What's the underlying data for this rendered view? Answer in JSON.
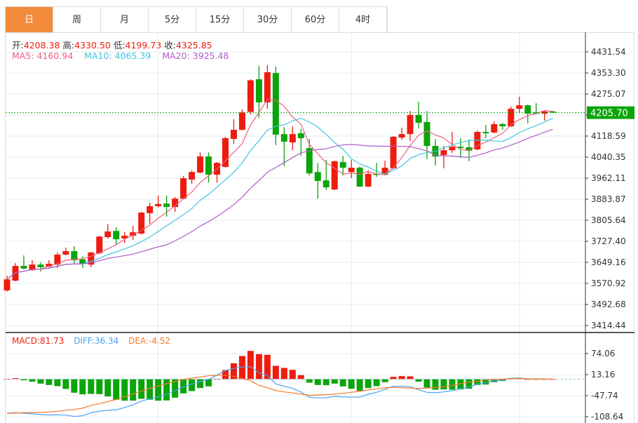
{
  "tabs": [
    {
      "label": "日",
      "active": true
    },
    {
      "label": "周",
      "active": false
    },
    {
      "label": "月",
      "active": false
    },
    {
      "label": "5分",
      "active": false
    },
    {
      "label": "15分",
      "active": false
    },
    {
      "label": "30分",
      "active": false
    },
    {
      "label": "60分",
      "active": false
    },
    {
      "label": "4时",
      "active": false
    }
  ],
  "ohlc_info": {
    "open_label": "开:",
    "open": "4208.38",
    "high_label": "高:",
    "high": "4330.50",
    "low_label": "低:",
    "low": "4199.73",
    "close_label": "收:",
    "close": "4325.85"
  },
  "ma_info": {
    "ma5": "MA5: 4160.94",
    "ma10": "MA10: 4065.39",
    "ma20": "MA20: 3925.48"
  },
  "macd_info": {
    "macd": "MACD:81.73",
    "diff": "DIFF:36.34",
    "dea": "DEA:-4.52"
  },
  "colors": {
    "up": "#ee1c0f",
    "down": "#0aa50a",
    "ma5": "#f0607f",
    "ma10": "#3fc6e0",
    "ma20": "#b05cc8",
    "diff": "#4aa3f0",
    "dea": "#f7792a",
    "active_tab": "#f28b3c",
    "last_price_bg": "#0aa50a"
  },
  "chart_data": [
    {
      "type": "candlestick",
      "price_ticks": [
        "4431.54",
        "4353.30",
        "4275.07",
        "4196.83",
        "4118.59",
        "4040.35",
        "3962.11",
        "3883.87",
        "3805.64",
        "3727.40",
        "3649.16",
        "3570.92",
        "3492.68",
        "3414.44"
      ],
      "last_price": "4205.70",
      "candle_fields": [
        "open",
        "close",
        "high",
        "low"
      ],
      "candles": [
        [
          3545,
          3586,
          3600,
          3540
        ],
        [
          3581,
          3636,
          3646,
          3579
        ],
        [
          3636,
          3626,
          3675,
          3623
        ],
        [
          3620,
          3641,
          3657,
          3618
        ],
        [
          3641,
          3631,
          3649,
          3615
        ],
        [
          3633,
          3644,
          3657,
          3631
        ],
        [
          3641,
          3678,
          3686,
          3628
        ],
        [
          3678,
          3691,
          3704,
          3675
        ],
        [
          3691,
          3657,
          3709,
          3646
        ],
        [
          3660,
          3644,
          3672,
          3628
        ],
        [
          3641,
          3686,
          3688,
          3631
        ],
        [
          3683,
          3745,
          3748,
          3680
        ],
        [
          3743,
          3764,
          3792,
          3738
        ],
        [
          3766,
          3735,
          3780,
          3717
        ],
        [
          3738,
          3748,
          3761,
          3722
        ],
        [
          3748,
          3761,
          3785,
          3733
        ],
        [
          3756,
          3834,
          3837,
          3753
        ],
        [
          3832,
          3858,
          3871,
          3792
        ],
        [
          3858,
          3866,
          3897,
          3853
        ],
        [
          3868,
          3855,
          3897,
          3819
        ],
        [
          3855,
          3886,
          3892,
          3837
        ],
        [
          3886,
          3962,
          3970,
          3884
        ],
        [
          3957,
          3985,
          3991,
          3941
        ],
        [
          3983,
          4043,
          4058,
          3980
        ],
        [
          4043,
          3975,
          4058,
          3946
        ],
        [
          3975,
          4019,
          4022,
          3946
        ],
        [
          4004,
          4111,
          4116,
          4001
        ],
        [
          4108,
          4142,
          4181,
          4090
        ],
        [
          4142,
          4207,
          4218,
          4139
        ],
        [
          4208.38,
          4325.85,
          4330.5,
          4199.73
        ],
        [
          4330,
          4244,
          4379,
          4186
        ],
        [
          4244,
          4356,
          4382,
          4220
        ],
        [
          4353,
          4124,
          4377,
          4085
        ],
        [
          4126,
          4098,
          4152,
          4006
        ],
        [
          4095,
          4126,
          4155,
          4066
        ],
        [
          4129,
          4111,
          4145,
          4045
        ],
        [
          4074,
          3980,
          4108,
          3972
        ],
        [
          3985,
          3952,
          4019,
          3886
        ],
        [
          3954,
          3928,
          4030,
          3918
        ],
        [
          3920,
          4025,
          4027,
          3918
        ],
        [
          4022,
          4001,
          4045,
          3972
        ],
        [
          3985,
          4001,
          4030,
          3962
        ],
        [
          4001,
          3931,
          4006,
          3928
        ],
        [
          3931,
          3978,
          3991,
          3928
        ],
        [
          3978,
          3975,
          4019,
          3967
        ],
        [
          3975,
          4001,
          4027,
          3972
        ],
        [
          3999,
          4116,
          4119,
          3996
        ],
        [
          4113,
          4126,
          4150,
          4105
        ],
        [
          4126,
          4197,
          4212,
          4100
        ],
        [
          4197,
          4168,
          4246,
          4147
        ],
        [
          4171,
          4082,
          4212,
          4033
        ],
        [
          4082,
          4043,
          4108,
          4009
        ],
        [
          4048,
          4066,
          4082,
          3999
        ],
        [
          4066,
          4079,
          4134,
          4056
        ],
        [
          4079,
          4074,
          4111,
          4038
        ],
        [
          4077,
          4064,
          4106,
          4025
        ],
        [
          4069,
          4134,
          4139,
          4066
        ],
        [
          4134,
          4129,
          4160,
          4111
        ],
        [
          4132,
          4163,
          4173,
          4129
        ],
        [
          4163,
          4155,
          4168,
          4142
        ],
        [
          4155,
          4220,
          4228,
          4152
        ],
        [
          4220,
          4233,
          4265,
          4205
        ],
        [
          4233,
          4202,
          4236,
          4166
        ],
        [
          4207,
          4202,
          4241,
          4199
        ],
        [
          4202,
          4210,
          4215,
          4176
        ],
        [
          4210,
          4205.7,
          4212,
          4204
        ]
      ],
      "moving_averages": [
        5,
        10,
        20
      ],
      "grid": true
    },
    {
      "type": "bar+line",
      "name": "MACD",
      "ticks": [
        "74.06",
        "13.16",
        "-47.74",
        "-108.64"
      ],
      "macd": [
        1,
        2.7,
        -3.4,
        -7.4,
        -12.9,
        -16.9,
        -20.3,
        -28.4,
        -39.3,
        -44,
        -42.7,
        -43.3,
        -50.1,
        -59.6,
        -62.3,
        -62.3,
        -56.9,
        -59.6,
        -62.3,
        -61.6,
        -53.5,
        -41.3,
        -34.5,
        -25.7,
        -21,
        1,
        26.4,
        46,
        67,
        81.73,
        72.4,
        70.4,
        38.6,
        32.5,
        27,
        11.5,
        -10.2,
        -16.9,
        -17.6,
        -12.9,
        -21,
        -27.8,
        -33.9,
        -25.7,
        -20.3,
        -8.8,
        6.8,
        8.8,
        8.1,
        -7.4,
        -24.4,
        -30.5,
        -29.8,
        -30.5,
        -29.8,
        -27.8,
        -16.9,
        -15.6,
        -8.8,
        -5.4,
        2.7,
        2.7,
        0,
        0,
        0,
        0
      ],
      "diff": [
        -98.5,
        -96.7,
        -98.7,
        -100.2,
        -102.5,
        -103.5,
        -103.2,
        -104.2,
        -107.7,
        -106,
        -97.4,
        -92.7,
        -90.1,
        -88.8,
        -82.2,
        -74.2,
        -63.5,
        -56.8,
        -51.2,
        -43.8,
        -33.8,
        -21.7,
        -14.3,
        -6.9,
        -0.5,
        11.5,
        25.2,
        31,
        35.5,
        36.34,
        18.2,
        10.2,
        -13.7,
        -20.8,
        -26.5,
        -37.3,
        -52.1,
        -54.5,
        -53.8,
        -49.5,
        -51.5,
        -51.9,
        -52,
        -43.9,
        -38.2,
        -29.4,
        -20.6,
        -20.6,
        -22,
        -30.7,
        -38.2,
        -39.3,
        -36.9,
        -33.3,
        -27.9,
        -22.9,
        -14.5,
        -10.8,
        -5.4,
        -2.7,
        2.9,
        3.4,
        1,
        0.5,
        0.3,
        0.2
      ],
      "dea": [
        -99,
        -98,
        -97,
        -96.5,
        -96,
        -95,
        -93,
        -90,
        -88,
        -84,
        -76,
        -71,
        -65,
        -59,
        -51,
        -43,
        -35,
        -27,
        -20,
        -13,
        -7,
        -1,
        3,
        6,
        10,
        11,
        12,
        8,
        2,
        -4.52,
        -18,
        -25,
        -33,
        -37,
        -40,
        -43,
        -47,
        -46,
        -45,
        -43,
        -41,
        -38,
        -35,
        -31,
        -28,
        -25,
        -24,
        -25,
        -26,
        -27,
        -26,
        -24,
        -22,
        -18,
        -13,
        -9,
        -6,
        -3,
        -1,
        0,
        1.5,
        2,
        1,
        0.5,
        0.3,
        0.2
      ]
    }
  ]
}
